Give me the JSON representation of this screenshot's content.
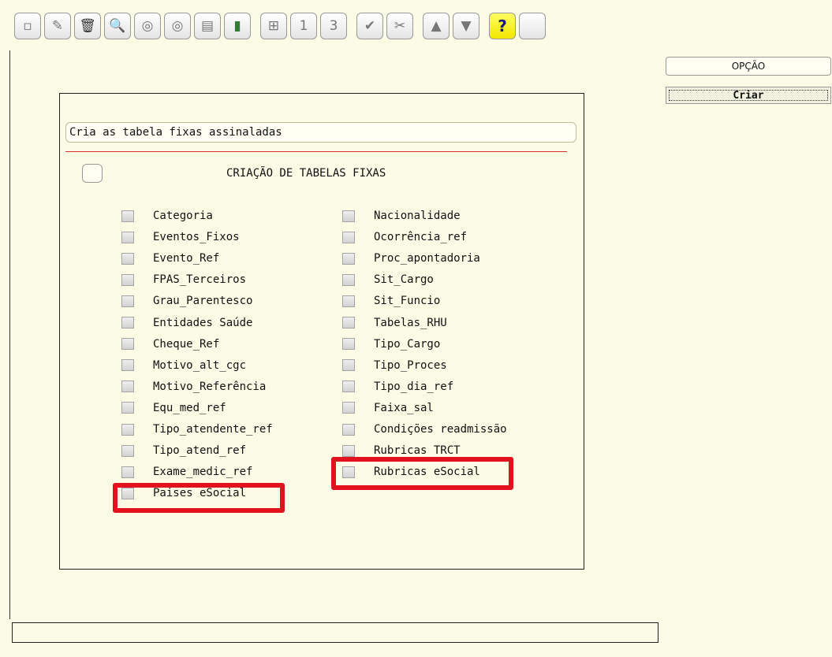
{
  "toolbar": {
    "icons": [
      "new-doc-icon",
      "edit-pencil-icon",
      "trash-icon",
      "search-icon",
      "prev-circle-icon",
      "next-circle-icon",
      "print-icon",
      "exit-door-icon",
      "binoculars-icon",
      "rank-first-icon",
      "rank-third-icon",
      "check-icon",
      "tools-icon",
      "up-triangle-icon",
      "filter-icon",
      "help-icon",
      "blank-icon"
    ],
    "glyphs": [
      "▫",
      "✎",
      "🗑",
      "🔍",
      "◎",
      "◎",
      "▤",
      "▮",
      "⊞",
      "1",
      "3",
      "✔",
      "✂",
      "▲",
      "▼",
      "?",
      ""
    ]
  },
  "description": "Cria as tabela fixas assinaladas",
  "title": "CRIAÇÃO DE TABELAS FIXAS",
  "left_items": [
    "Categoria",
    "Eventos_Fixos",
    "Evento_Ref",
    "FPAS_Terceiros",
    "Grau_Parentesco",
    "Entidades Saúde",
    "Cheque_Ref",
    "Motivo_alt_cgc",
    "Motivo_Referência",
    "Equ_med_ref",
    "Tipo_atendente_ref",
    "Tipo_atend_ref",
    "Exame_medic_ref",
    "Paises eSocial"
  ],
  "right_items": [
    "Nacionalidade",
    "Ocorrência_ref",
    "Proc_apontadoria",
    "Sit_Cargo",
    "Sit_Funcio",
    "Tabelas_RHU",
    "Tipo_Cargo",
    "Tipo_Proces",
    "Tipo_dia_ref",
    "Faixa_sal",
    "Condições readmissão",
    "Rubricas TRCT",
    "Rubricas eSocial"
  ],
  "side": {
    "option_label": "OPÇÃO",
    "create_label": "Criar"
  },
  "colors": {
    "highlight": "#e2131e",
    "background": "#fbfbe6"
  }
}
